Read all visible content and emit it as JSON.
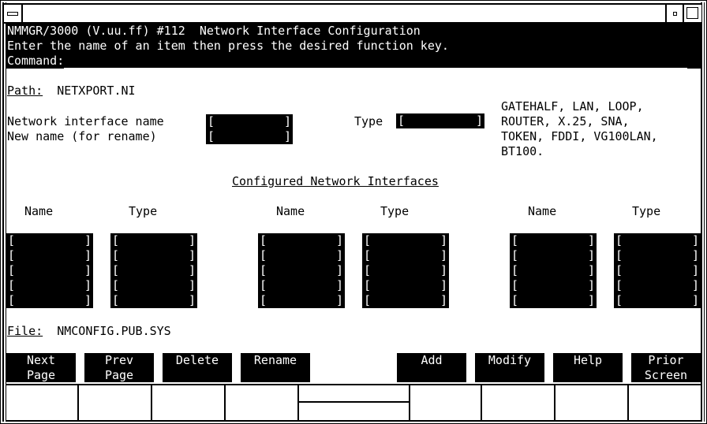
{
  "window": {
    "menu_icon": "window-menu-icon",
    "minimize_icon": "minimize-icon",
    "maximize_icon": "maximize-icon"
  },
  "header": {
    "line1": "NMMGR/3000 (V.uu.ff) #112  Network Interface Configuration",
    "line2": "Enter the name of an item then press the desired function key.",
    "command_label": "Command:",
    "command_value": ""
  },
  "path": {
    "label": "Path:",
    "value": "NETXPORT.NI"
  },
  "form": {
    "ni_name_label": "Network interface name",
    "ni_name_value": "",
    "new_name_label": "New name (for rename)",
    "new_name_value": "",
    "type_label": "Type",
    "type_value": "",
    "type_options_lines": [
      "GATEHALF, LAN, LOOP,",
      "ROUTER, X.25, SNA,",
      "TOKEN, FDDI, VG100LAN,",
      "BT100."
    ]
  },
  "configured": {
    "title": "Configured Network Interfaces",
    "name_header": "Name",
    "type_header": "Type",
    "groups": [
      {
        "names": [
          "",
          "",
          "",
          "",
          ""
        ],
        "types": [
          "",
          "",
          "",
          "",
          ""
        ]
      },
      {
        "names": [
          "",
          "",
          "",
          "",
          ""
        ],
        "types": [
          "",
          "",
          "",
          "",
          ""
        ]
      },
      {
        "names": [
          "",
          "",
          "",
          "",
          ""
        ],
        "types": [
          "",
          "",
          "",
          "",
          ""
        ]
      }
    ]
  },
  "file": {
    "label": "File:",
    "value": "NMCONFIG.PUB.SYS"
  },
  "function_keys": [
    {
      "label": "Next\nPage"
    },
    {
      "label": "Prev\nPage"
    },
    {
      "label": "Delete"
    },
    {
      "label": "Rename"
    },
    {
      "label": "Add"
    },
    {
      "label": "Modify"
    },
    {
      "label": "Help"
    },
    {
      "label": "Prior\nScreen"
    }
  ]
}
